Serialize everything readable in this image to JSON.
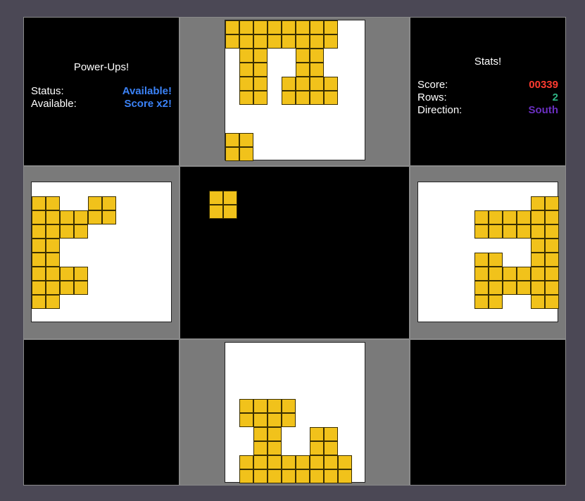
{
  "powerups": {
    "title": "Power-Ups!",
    "status_label": "Status:",
    "status_value": "Available!",
    "available_label": "Available:",
    "available_value": "Score x2!",
    "value_color": "#3b82f6"
  },
  "stats": {
    "title": "Stats!",
    "score_label": "Score:",
    "score_value": "00339",
    "score_color": "#ff3b30",
    "rows_label": "Rows:",
    "rows_value": "2",
    "rows_color": "#2fb585",
    "direction_label": "Direction:",
    "direction_value": "South",
    "direction_color": "#6a2fc0"
  },
  "colors": {
    "block": "#f1c21b",
    "block_border": "#3a2f00",
    "background": "#4b4855"
  },
  "boards": {
    "north": [
      [
        0,
        0
      ],
      [
        1,
        0
      ],
      [
        2,
        0
      ],
      [
        3,
        0
      ],
      [
        4,
        0
      ],
      [
        5,
        0
      ],
      [
        6,
        0
      ],
      [
        7,
        0
      ],
      [
        0,
        1
      ],
      [
        1,
        1
      ],
      [
        2,
        1
      ],
      [
        3,
        1
      ],
      [
        4,
        1
      ],
      [
        5,
        1
      ],
      [
        6,
        1
      ],
      [
        7,
        1
      ],
      [
        1,
        2
      ],
      [
        2,
        2
      ],
      [
        5,
        2
      ],
      [
        6,
        2
      ],
      [
        1,
        3
      ],
      [
        2,
        3
      ],
      [
        5,
        3
      ],
      [
        6,
        3
      ],
      [
        1,
        4
      ],
      [
        2,
        4
      ],
      [
        4,
        4
      ],
      [
        5,
        4
      ],
      [
        6,
        4
      ],
      [
        7,
        4
      ],
      [
        1,
        5
      ],
      [
        2,
        5
      ],
      [
        4,
        5
      ],
      [
        5,
        5
      ],
      [
        6,
        5
      ],
      [
        7,
        5
      ],
      [
        0,
        8
      ],
      [
        1,
        8
      ],
      [
        0,
        9
      ],
      [
        1,
        9
      ]
    ],
    "west": [
      [
        0,
        1
      ],
      [
        1,
        1
      ],
      [
        4,
        1
      ],
      [
        5,
        1
      ],
      [
        0,
        2
      ],
      [
        1,
        2
      ],
      [
        2,
        2
      ],
      [
        3,
        2
      ],
      [
        4,
        2
      ],
      [
        5,
        2
      ],
      [
        0,
        3
      ],
      [
        1,
        3
      ],
      [
        2,
        3
      ],
      [
        3,
        3
      ],
      [
        0,
        4
      ],
      [
        1,
        4
      ],
      [
        0,
        5
      ],
      [
        1,
        5
      ],
      [
        0,
        6
      ],
      [
        1,
        6
      ],
      [
        2,
        6
      ],
      [
        3,
        6
      ],
      [
        0,
        7
      ],
      [
        1,
        7
      ],
      [
        2,
        7
      ],
      [
        3,
        7
      ],
      [
        0,
        8
      ],
      [
        1,
        8
      ]
    ],
    "east": [
      [
        8,
        1
      ],
      [
        9,
        1
      ],
      [
        4,
        2
      ],
      [
        5,
        2
      ],
      [
        6,
        2
      ],
      [
        7,
        2
      ],
      [
        8,
        2
      ],
      [
        9,
        2
      ],
      [
        4,
        3
      ],
      [
        5,
        3
      ],
      [
        6,
        3
      ],
      [
        7,
        3
      ],
      [
        8,
        3
      ],
      [
        9,
        3
      ],
      [
        8,
        4
      ],
      [
        9,
        4
      ],
      [
        4,
        5
      ],
      [
        5,
        5
      ],
      [
        8,
        5
      ],
      [
        9,
        5
      ],
      [
        4,
        6
      ],
      [
        5,
        6
      ],
      [
        6,
        6
      ],
      [
        7,
        6
      ],
      [
        8,
        6
      ],
      [
        9,
        6
      ],
      [
        4,
        7
      ],
      [
        5,
        7
      ],
      [
        6,
        7
      ],
      [
        7,
        7
      ],
      [
        8,
        7
      ],
      [
        9,
        7
      ],
      [
        4,
        8
      ],
      [
        5,
        8
      ],
      [
        8,
        8
      ],
      [
        9,
        8
      ]
    ],
    "south": [
      [
        1,
        4
      ],
      [
        2,
        4
      ],
      [
        3,
        4
      ],
      [
        4,
        4
      ],
      [
        1,
        5
      ],
      [
        2,
        5
      ],
      [
        3,
        5
      ],
      [
        4,
        5
      ],
      [
        2,
        6
      ],
      [
        3,
        6
      ],
      [
        6,
        6
      ],
      [
        7,
        6
      ],
      [
        2,
        7
      ],
      [
        3,
        7
      ],
      [
        6,
        7
      ],
      [
        7,
        7
      ],
      [
        1,
        8
      ],
      [
        2,
        8
      ],
      [
        3,
        8
      ],
      [
        4,
        8
      ],
      [
        5,
        8
      ],
      [
        6,
        8
      ],
      [
        7,
        8
      ],
      [
        8,
        8
      ],
      [
        1,
        9
      ],
      [
        2,
        9
      ],
      [
        3,
        9
      ],
      [
        4,
        9
      ],
      [
        5,
        9
      ],
      [
        6,
        9
      ],
      [
        7,
        9
      ],
      [
        8,
        9
      ]
    ],
    "center": [
      [
        0,
        0
      ],
      [
        1,
        0
      ],
      [
        0,
        1
      ],
      [
        1,
        1
      ]
    ]
  }
}
